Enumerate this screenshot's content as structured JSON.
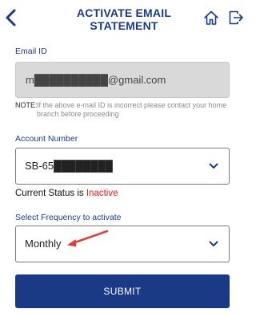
{
  "header": {
    "title": "ACTIVATE EMAIL STATEMENT",
    "back_icon": "chevron-left-icon",
    "home_icon": "home-icon",
    "logout_icon": "logout-icon"
  },
  "email": {
    "label": "Email ID",
    "value": "m██████████@gmail.com"
  },
  "note": {
    "label": "NOTE:",
    "text": "If the above e-mail ID is incorrect please contact your home branch before proceeding"
  },
  "account": {
    "label": "Account Number",
    "value": "SB-65████████"
  },
  "status": {
    "label": "Current Status is",
    "value": "Inactive"
  },
  "frequency": {
    "label": "Select Frequency to activate",
    "value": "Monthly"
  },
  "submit": {
    "label": "SUBMIT"
  },
  "colors": {
    "primary": "#1b3a86",
    "inactive": "#e21c1c",
    "annotation_arrow": "#e0403a"
  }
}
